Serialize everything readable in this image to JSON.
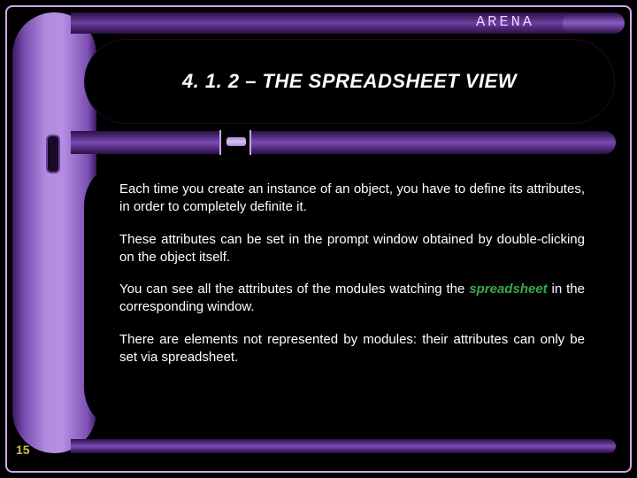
{
  "header": {
    "app_label": "ARENA"
  },
  "title": "4. 1. 2 – THE SPREADSHEET VIEW",
  "body": {
    "p1": "Each time you create an instance of an object, you have to define its attributes, in order to completely definite it.",
    "p2": "These attributes can be set in the prompt window obtained by double-clicking on the object itself.",
    "p3_pre": "You can see all the attributes of the modules watching the ",
    "p3_kw": "spreadsheet",
    "p3_post": " in the corresponding window.",
    "p4": "There are elements not represented by modules: their attributes can only be set via spreadsheet."
  },
  "page_number": "15"
}
